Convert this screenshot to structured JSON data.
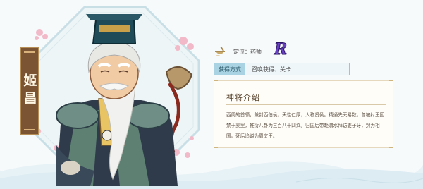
{
  "character": {
    "name": "姬昌",
    "role_label": "定位：药师",
    "rank": "R"
  },
  "obtain": {
    "tag_label": "获得方式",
    "value": "召唤获得、关卡"
  },
  "intro": {
    "title": "神将介绍",
    "body": "西周的首领，兼封西伯侯。天性仁厚，人称贤侯。精通先天易数。曾被纣王囚禁于羑里，推衍八卦为三百八十四爻。归国后带赴渭水拜访姜子牙，封为相国。死后追谥为周文王。"
  },
  "colors": {
    "accent_teal": "#a9d3e3",
    "banner_brown": "#7a5433",
    "rank_purple": "#6a3fc8"
  }
}
